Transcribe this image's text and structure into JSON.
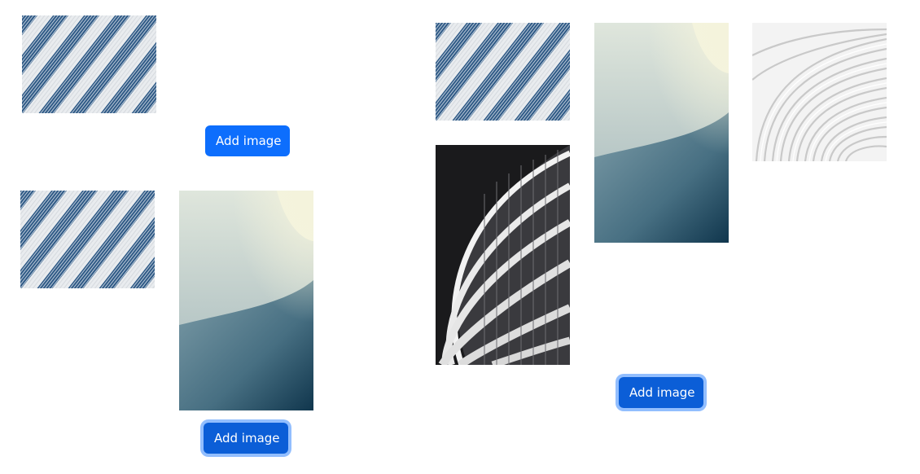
{
  "colors": {
    "button_bg": "#0d6efd",
    "button_focus_bg": "#0b5ed7",
    "button_text": "#ffffff",
    "page_bg": "#ffffff"
  },
  "images": {
    "stripes": "diagonal-blue-stripes-image",
    "curve": "teal-curved-wall-image",
    "building": "black-white-curved-building-image",
    "waves": "white-wavy-lines-image"
  },
  "panel_a": {
    "button_label": "Add image"
  },
  "panel_b": {
    "button_label": "Add image"
  },
  "panel_c": {
    "button_label": "Add image"
  }
}
